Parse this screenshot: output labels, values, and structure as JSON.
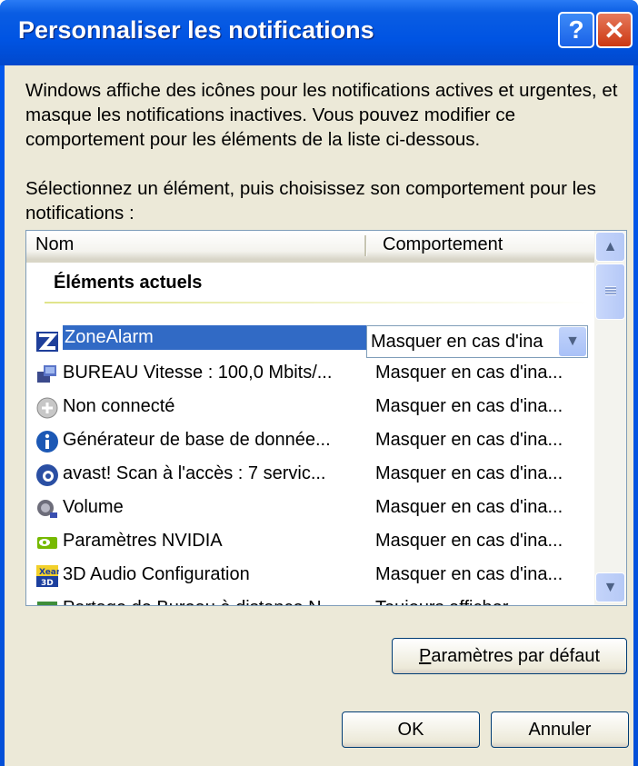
{
  "window": {
    "title": "Personnaliser les notifications",
    "help_label": "?",
    "close_label": "✕"
  },
  "intro": "Windows affiche des icônes pour les notifications actives et urgentes, et masque les notifications inactives. Vous pouvez modifier ce comportement pour les éléments de la liste ci-dessous.",
  "instruction": "Sélectionnez un élément, puis choisissez son comportement pour les notifications :",
  "list": {
    "columns": {
      "name": "Nom",
      "behavior": "Comportement"
    },
    "group_label": "Éléments actuels",
    "selected_value": "Masquer en cas d'ina",
    "items": [
      {
        "name": "ZoneAlarm",
        "behavior": "Masquer en cas d'ina",
        "icon": "zonealarm-icon",
        "selected": true
      },
      {
        "name": "BUREAU Vitesse : 100,0 Mbits/...",
        "behavior": "Masquer en cas d'ina...",
        "icon": "network-icon"
      },
      {
        "name": "Non connecté",
        "behavior": "Masquer en cas d'ina...",
        "icon": "disconnected-icon"
      },
      {
        "name": "Générateur de base de donnée...",
        "behavior": "Masquer en cas d'ina...",
        "icon": "info-icon"
      },
      {
        "name": "avast! Scan à l'accès : 7 servic...",
        "behavior": "Masquer en cas d'ina...",
        "icon": "avast-icon"
      },
      {
        "name": "Volume",
        "behavior": "Masquer en cas d'ina...",
        "icon": "volume-icon"
      },
      {
        "name": "Paramètres NVIDIA",
        "behavior": "Masquer en cas d'ina...",
        "icon": "nvidia-icon"
      },
      {
        "name": "3D Audio Configuration",
        "behavior": "Masquer en cas d'ina...",
        "icon": "xear-icon"
      },
      {
        "name": "Partage de Bureau à distance N...",
        "behavior": "Toujours afficher",
        "icon": "remote-desktop-icon"
      }
    ]
  },
  "buttons": {
    "defaults": "Paramètres par défaut",
    "defaults_accel": "P",
    "defaults_rest": "aramètres par défaut",
    "ok": "OK",
    "cancel": "Annuler"
  },
  "colors": {
    "titlebar": "#0054e3",
    "face": "#ece9d8",
    "selection": "#316ac5",
    "close_button": "#cc3812"
  }
}
